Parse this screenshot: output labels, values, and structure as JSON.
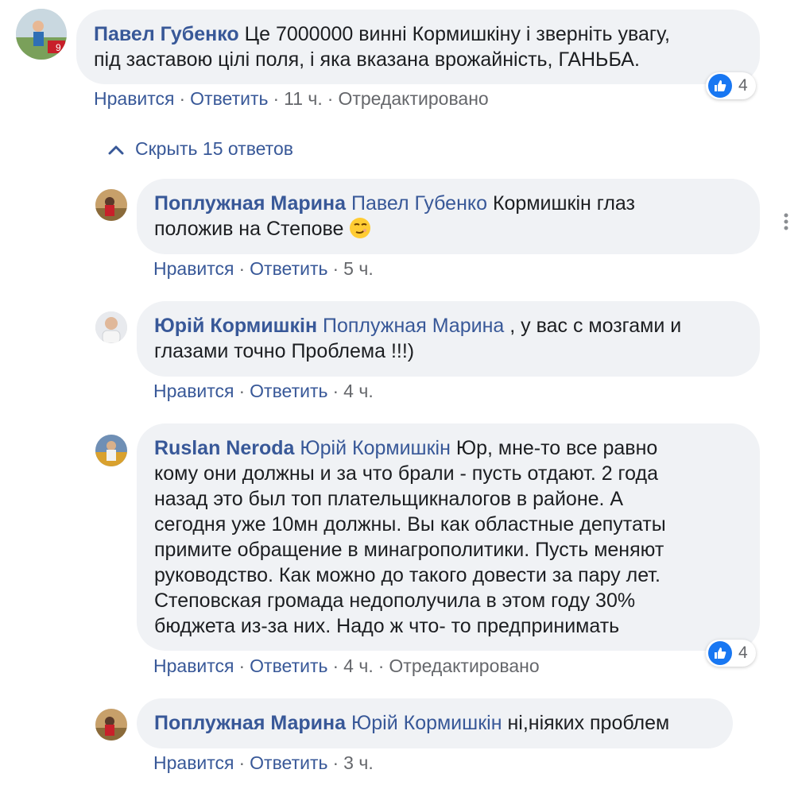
{
  "thread": {
    "root": {
      "author": "Павел Губенко",
      "text_line1": "Це 7000000 винні Кормишкіну і зверніть увагу,",
      "text_line2": "під заставою цілі поля, і яка вказана врожайність, ГАНЬБА.",
      "like_label": "Нравится",
      "reply_label": "Ответить",
      "time": "11 ч.",
      "edited": "Отредактировано",
      "reaction_count": "4"
    },
    "replies_toggle": {
      "icon": "chevron-up-icon",
      "label": "Скрыть 15 ответов"
    },
    "replies": [
      {
        "author": "Поплужная Марина",
        "mention": "Павел Губенко",
        "text_a": "Кормишкін глаз",
        "text_b": "положив на Степове",
        "emoji": "smirk-emoji",
        "like_label": "Нравится",
        "reply_label": "Ответить",
        "time": "5 ч."
      },
      {
        "author": "Юрій Кормишкін",
        "mention": "Поплужная Марина",
        "text_a": ", у вас с мозгами и",
        "text_b": "глазами точно Проблема !!!)",
        "like_label": "Нравится",
        "reply_label": "Ответить",
        "time": "4 ч."
      },
      {
        "author": "Ruslan Neroda",
        "mention": "Юрій Кормишкін",
        "text_a": "Юр, мне-то все равно",
        "text_lines": [
          "кому они должны и за что брали - пусть отдают. 2 года",
          "назад это был топ плательщикналогов в районе. А",
          "сегодня уже 10мн должны. Вы как областные депутаты",
          "примите обращение в минагрополитики. Пусть меняют",
          "руководство. Как можно до такого довести за пару лет.",
          "Степовская громада недополучила в этом году 30%",
          "бюджета из-за них. Надо ж что- то предпринимать"
        ],
        "like_label": "Нравится",
        "reply_label": "Ответить",
        "time": "4 ч.",
        "edited": "Отредактировано",
        "reaction_count": "4"
      },
      {
        "author": "Поплужная Марина",
        "mention": "Юрій Кормишкін",
        "text_a": "ні,ніяких проблем",
        "like_label": "Нравится",
        "reply_label": "Ответить",
        "time": "3 ч."
      }
    ],
    "colors": {
      "link": "#385898",
      "meta": "#65676b",
      "bubble": "#f0f2f5",
      "like_blue": "#1877f2"
    }
  }
}
